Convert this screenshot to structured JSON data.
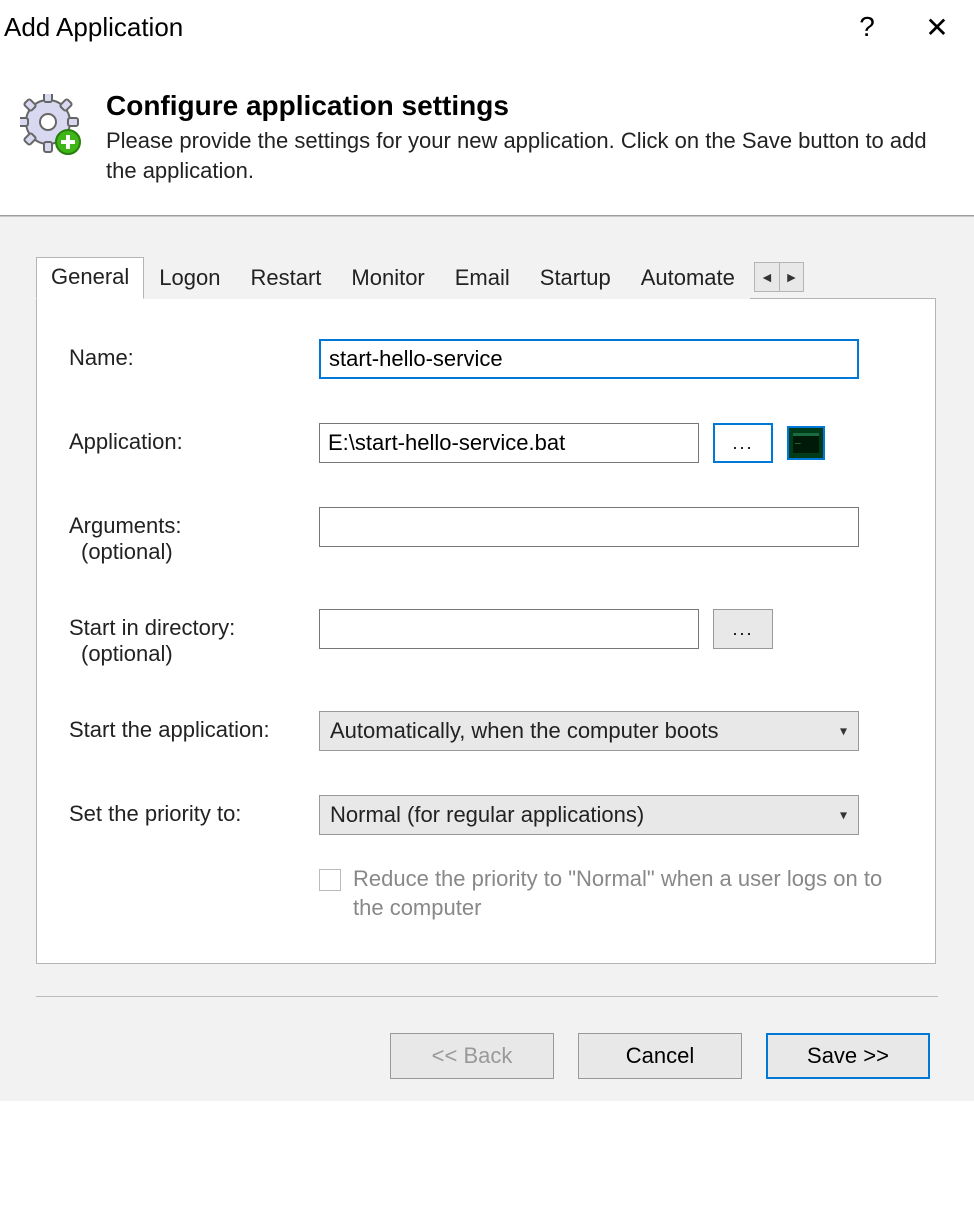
{
  "window": {
    "title": "Add Application"
  },
  "header": {
    "title": "Configure application settings",
    "description": "Please provide the settings for your new application. Click on the Save button to add the application."
  },
  "tabs": [
    "General",
    "Logon",
    "Restart",
    "Monitor",
    "Email",
    "Startup",
    "Automate"
  ],
  "activeTab": "General",
  "form": {
    "nameLabel": "Name:",
    "nameValue": "start-hello-service",
    "appLabel": "Application:",
    "appValue": "E:\\start-hello-service.bat",
    "browseLabel": "...",
    "argsLabel": "Arguments:",
    "argsSub": "(optional)",
    "argsValue": "",
    "dirLabel": "Start in directory:",
    "dirSub": "(optional)",
    "dirValue": "",
    "dirBrowseLabel": "...",
    "startLabel": "Start the application:",
    "startValue": "Automatically, when the computer boots",
    "priorityLabel": "Set the priority to:",
    "priorityValue": "Normal (for regular applications)",
    "reduceLabel": "Reduce the priority to \"Normal\" when a user logs on to the computer"
  },
  "buttons": {
    "back": "<< Back",
    "cancel": "Cancel",
    "save": "Save >>"
  }
}
